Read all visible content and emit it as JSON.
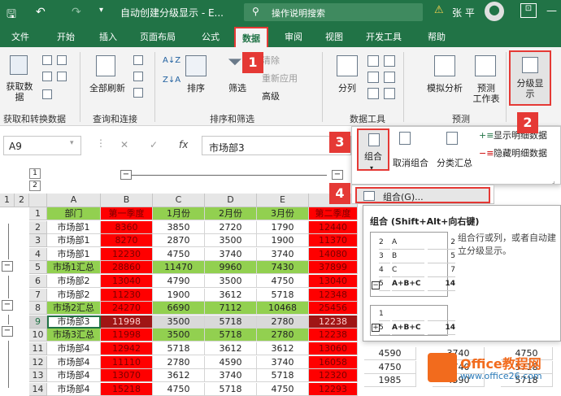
{
  "title": {
    "doc": "自动创建分级显示 - E...",
    "search_placeholder": "操作说明搜索",
    "user": "张 平",
    "warning": "⚠"
  },
  "tabs": [
    "文件",
    "开始",
    "插入",
    "页面布局",
    "公式",
    "数据",
    "审阅",
    "视图",
    "开发工具",
    "帮助"
  ],
  "ribbon": {
    "get_data": "获取数\n据",
    "grp1": "获取和转换数据",
    "refresh_all": "全部刷新",
    "grp2": "查询和连接",
    "sort": "排序",
    "filter": "筛选",
    "clear": "清除",
    "reapply": "重新应用",
    "advanced": "高级",
    "grp3": "排序和筛选",
    "split": "分列",
    "grp4": "数据工具",
    "whatif": "模拟分析",
    "forecast": "预测\n工作表",
    "grp5": "预测",
    "outline": "分级显\n示"
  },
  "outline_popup": {
    "group": "组合",
    "ungroup": "取消组合",
    "subtotal": "分类汇总",
    "show_detail": "显示明细数据",
    "hide_detail": "隐藏明细数据"
  },
  "menu": {
    "group_item": "组合(G)..."
  },
  "tooltip": {
    "title": "组合 (Shift+Alt+向右键)",
    "desc": "组合行或列，或者自动建立分级显示。",
    "mini1": [
      [
        "2",
        "A",
        "2"
      ],
      [
        "3",
        "B",
        "5"
      ],
      [
        "4",
        "C",
        "7"
      ],
      [
        "5",
        "A+B+C",
        "14"
      ]
    ],
    "mini2": [
      [
        "1",
        "",
        ""
      ],
      [
        "5",
        "A+B+C",
        "14"
      ]
    ]
  },
  "namebox": "A9",
  "formula": "市场部3",
  "badges": [
    "1",
    "2",
    "3",
    "4"
  ],
  "level_buttons": [
    "1",
    "2"
  ],
  "col_levels": [
    "1",
    "2"
  ],
  "cols": [
    "A",
    "B",
    "C",
    "D",
    "E",
    "F"
  ],
  "rows": [
    {
      "n": "1",
      "a": "部门",
      "b": "第一季度",
      "c": "1月份",
      "d": "2月份",
      "e": "3月份",
      "f": "第二季度",
      "t": "hdr"
    },
    {
      "n": "2",
      "a": "市场部1",
      "b": "8360",
      "c": "3850",
      "d": "2720",
      "e": "1790",
      "f": "12440",
      "t": ""
    },
    {
      "n": "3",
      "a": "市场部1",
      "b": "8270",
      "c": "2870",
      "d": "3500",
      "e": "1900",
      "f": "11370",
      "t": ""
    },
    {
      "n": "4",
      "a": "市场部1",
      "b": "12230",
      "c": "4750",
      "d": "3740",
      "e": "3740",
      "f": "14080",
      "t": ""
    },
    {
      "n": "5",
      "a": "市场1汇总",
      "b": "28860",
      "c": "11470",
      "d": "9960",
      "e": "7430",
      "f": "37899",
      "t": "sum"
    },
    {
      "n": "6",
      "a": "市场部2",
      "b": "13040",
      "c": "4790",
      "d": "3500",
      "e": "4750",
      "f": "13040",
      "t": ""
    },
    {
      "n": "7",
      "a": "市场部2",
      "b": "11230",
      "c": "1900",
      "d": "3612",
      "e": "5718",
      "f": "12348",
      "t": ""
    },
    {
      "n": "8",
      "a": "市场2汇总",
      "b": "24270",
      "c": "6690",
      "d": "7112",
      "e": "10468",
      "f": "25456",
      "t": "sum"
    },
    {
      "n": "9",
      "a": "市场部3",
      "b": "11998",
      "c": "3500",
      "d": "5718",
      "e": "2780",
      "f": "12238",
      "t": "sel"
    },
    {
      "n": "10",
      "a": "市场3汇总",
      "b": "11998",
      "c": "3500",
      "d": "5718",
      "e": "2780",
      "f": "12238",
      "t": "sum"
    },
    {
      "n": "11",
      "a": "市场部4",
      "b": "12942",
      "c": "5718",
      "d": "3612",
      "e": "3612",
      "f": "13060",
      "t": ""
    },
    {
      "n": "12",
      "a": "市场部4",
      "b": "11110",
      "c": "2780",
      "d": "4590",
      "e": "3740",
      "f": "16058",
      "t": ""
    },
    {
      "n": "13",
      "a": "市场部4",
      "b": "13070",
      "c": "3612",
      "d": "3740",
      "e": "5718",
      "f": "12320",
      "t": ""
    },
    {
      "n": "14",
      "a": "市场部4",
      "b": "15218",
      "c": "4750",
      "d": "5718",
      "e": "4750",
      "f": "12293",
      "t": ""
    }
  ],
  "extra_cols": [
    {
      "row": 12,
      "g": "4590",
      "h": "3740",
      "i": "4750"
    },
    {
      "row": 13,
      "g": "4750",
      "h": "3740",
      "i": "5718"
    },
    {
      "row": 14,
      "g": "1985",
      "h": "4590",
      "i": "5718"
    }
  ],
  "watermark": {
    "brand": "Office教程网",
    "url": "www.office26.com"
  }
}
